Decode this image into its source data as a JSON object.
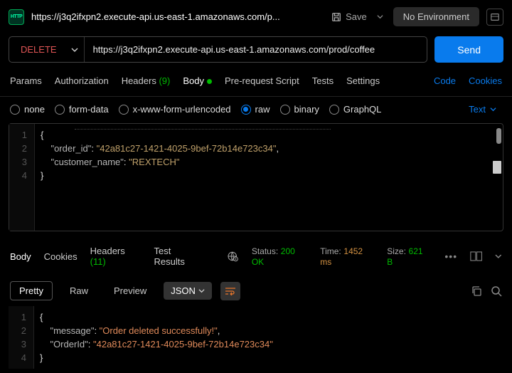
{
  "header": {
    "tab_title": "https://j3q2ifxpn2.execute-api.us-east-1.amazonaws.com/p...",
    "save": "Save",
    "environment": "No Environment"
  },
  "request": {
    "method": "DELETE",
    "url": "https://j3q2ifxpn2.execute-api.us-east-1.amazonaws.com/prod/coffee",
    "send": "Send"
  },
  "req_tabs": {
    "params": "Params",
    "auth": "Authorization",
    "headers": "Headers",
    "headers_count": "(9)",
    "body": "Body",
    "pre": "Pre-request Script",
    "tests": "Tests",
    "settings": "Settings",
    "code": "Code",
    "cookies": "Cookies"
  },
  "body_types": {
    "none": "none",
    "formdata": "form-data",
    "xwww": "x-www-form-urlencoded",
    "raw": "raw",
    "binary": "binary",
    "graphql": "GraphQL",
    "text": "Text"
  },
  "req_body": {
    "lines": [
      "1",
      "2",
      "3",
      "4"
    ],
    "l1": "{",
    "l2_ind": "    ",
    "l2_key": "\"order_id\"",
    "l2_sep": ": ",
    "l2_val": "\"42a81c27-1421-4025-9bef-72b14e723c34\"",
    "l2_end": ",",
    "l3_ind": "    ",
    "l3_key": "\"customer_name\"",
    "l3_sep": ": ",
    "l3_val": "\"REXTECH\"",
    "l4": "}"
  },
  "resp_tabs": {
    "body": "Body",
    "cookies": "Cookies",
    "headers": "Headers",
    "headers_count": "(11)",
    "tests": "Test Results"
  },
  "status": {
    "status_label": "Status:",
    "status_val": "200 OK",
    "time_label": "Time:",
    "time_val": "1452 ms",
    "size_label": "Size:",
    "size_val": "621 B"
  },
  "views": {
    "pretty": "Pretty",
    "raw": "Raw",
    "preview": "Preview",
    "format": "JSON"
  },
  "resp_body": {
    "lines": [
      "1",
      "2",
      "3",
      "4"
    ],
    "l1": "{",
    "l2_ind": "    ",
    "l2_key": "\"message\"",
    "l2_sep": ": ",
    "l2_val": "\"Order deleted successfully!\"",
    "l2_end": ",",
    "l3_ind": "    ",
    "l3_key": "\"OrderId\"",
    "l3_sep": ": ",
    "l3_val": "\"42a81c27-1421-4025-9bef-72b14e723c34\"",
    "l4": "}"
  }
}
